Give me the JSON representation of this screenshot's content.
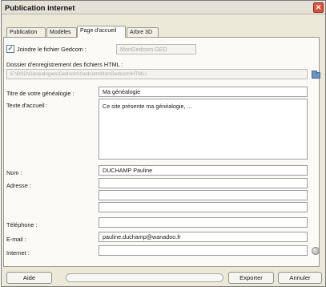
{
  "window": {
    "title": "Publication internet",
    "close_glyph": "✕"
  },
  "tabs": [
    {
      "label": "Publication",
      "active": false
    },
    {
      "label": "Modèles",
      "active": false
    },
    {
      "label": "Page d'accueil",
      "active": true
    },
    {
      "label": "Arbre 3D",
      "active": false
    }
  ],
  "gedcom": {
    "checkbox_label": "Joindre le fichier Gedcom :",
    "checked": true,
    "check_glyph": "✓",
    "filename": "MonGedcom.GED"
  },
  "html_folder": {
    "label": "Dossier d'enregistrement des fichiers HTML :",
    "path": "E:\\BSD\\Généalogies\\Gedcom\\Gedcom\\MonGedcom\\HTML\\"
  },
  "form": {
    "title_label": "Titre de votre généalogie :",
    "title_value": "Ma généalogie",
    "welcome_label": "Texte d'accueil :",
    "welcome_value": "Ce site présente ma généalogie, ...",
    "name_label": "Nom :",
    "name_value": "DUCHAMP Pauline",
    "address_label": "Adresse :",
    "address_lines": [
      "",
      "",
      ""
    ],
    "phone_label": "Téléphone :",
    "phone_value": "",
    "email_label": "E-mail :",
    "email_value": "pauline.duchamp@wanadoo.fr",
    "internet_label": "Internet :",
    "internet_value": ""
  },
  "buttons": {
    "help": "Aide",
    "export": "Exporter",
    "cancel": "Annuler"
  },
  "icons": {
    "browse": "folder-icon",
    "internet": "globe-icon"
  },
  "colors": {
    "accent": "#d9533a",
    "folder": "#6d93c3",
    "check": "#2b7a2b"
  }
}
